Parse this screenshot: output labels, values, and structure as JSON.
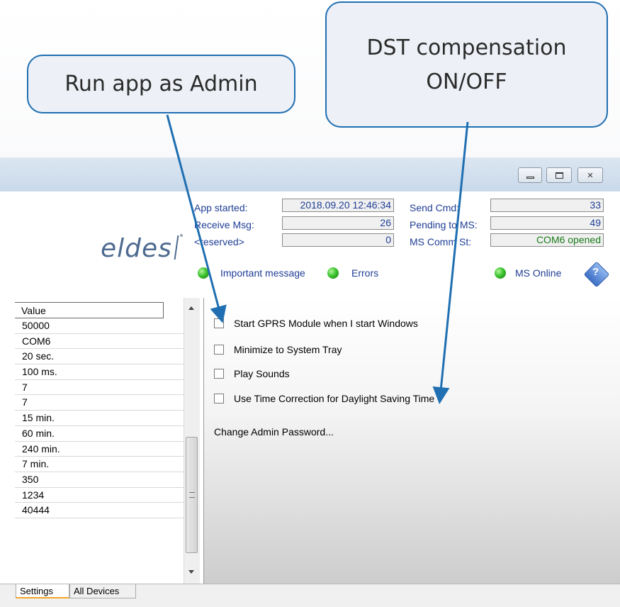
{
  "callouts": {
    "admin": "Run app as Admin",
    "dst_line1": "DST compensation",
    "dst_line2": "ON/OFF"
  },
  "window": {
    "buttons": {
      "minimize": "▭",
      "maximize": "⧠",
      "close": "✕"
    }
  },
  "header": {
    "logo": "eldes",
    "app_started_label": "App started:",
    "app_started_value": "2018.09.20 12:46:34",
    "receive_msg_label": "Receive Msg:",
    "receive_msg_value": "26",
    "reserved_label": "<reserved>",
    "reserved_value": "0",
    "send_cmd_label": "Send Cmd:",
    "send_cmd_value": "33",
    "pending_label": "Pending to MS:",
    "pending_value": "49",
    "ms_comm_label": "MS Comm St:",
    "ms_comm_value": "COM6 opened",
    "important_message": "Important message",
    "errors": "Errors",
    "ms_online": "MS Online"
  },
  "table": {
    "column": "Value",
    "rows": [
      "50000",
      "COM6",
      "20 sec.",
      "100 ms.",
      "7",
      "7",
      "15 min.",
      "60 min.",
      "240 min.",
      "7 min.",
      "350",
      "1234",
      "40444"
    ]
  },
  "options": {
    "gprs_autostart": "Start GPRS Module when I start Windows",
    "minimize_tray": "Minimize to System Tray",
    "play_sounds": "Play Sounds",
    "dst_correction": "Use Time Correction for Daylight Saving Time",
    "change_password": "Change Admin Password..."
  },
  "tabs": {
    "settings": "Settings",
    "all_devices": "All Devices"
  },
  "colors": {
    "accent": "#1f6fb2",
    "label_blue": "#1f3e95",
    "online_green": "#3cc42f",
    "status_green": "#1a7a1a"
  }
}
